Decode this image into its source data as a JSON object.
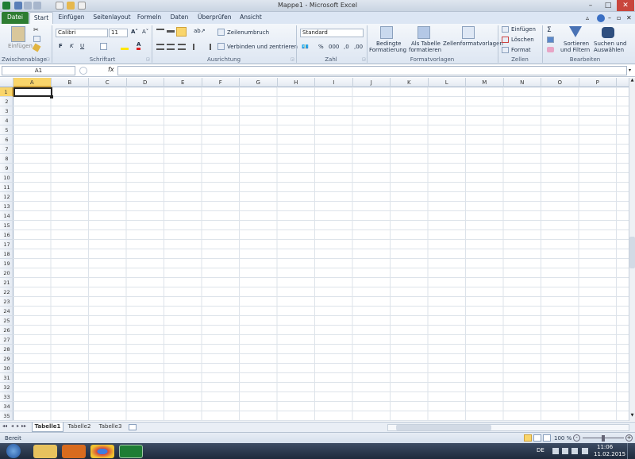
{
  "window": {
    "title": "Mappe1 - Microsoft Excel"
  },
  "tabs": [
    "Datei",
    "Start",
    "Einfügen",
    "Seitenlayout",
    "Formeln",
    "Daten",
    "Überprüfen",
    "Ansicht"
  ],
  "ribbon": {
    "paste_label": "Einfügen",
    "font_name": "Calibri",
    "font_size": "11",
    "bold": "F",
    "italic": "K",
    "underline": "U",
    "wrap_text": "Zeilenumbruch",
    "merge_center": "Verbinden und zentrieren",
    "number_format": "Standard",
    "cond_format": "Bedingte",
    "cond_format2": "Formatierung",
    "as_table": "Als Tabelle",
    "as_table2": "formatieren",
    "cell_styles": "Zellenformatvorlagen",
    "insert": "Einfügen",
    "delete": "Löschen",
    "format": "Format",
    "sort_filter": "Sortieren",
    "sort_filter2": "und Filtern",
    "find_select": "Suchen und",
    "find_select2": "Auswählen",
    "groups": {
      "clipboard": "Zwischenablage",
      "font": "Schriftart",
      "alignment": "Ausrichtung",
      "number": "Zahl",
      "styles": "Formatvorlagen",
      "cells": "Zellen",
      "editing": "Bearbeiten"
    }
  },
  "formula_bar": {
    "name_box": "A1",
    "fx": "fx",
    "value": ""
  },
  "columns": [
    "A",
    "B",
    "C",
    "D",
    "E",
    "F",
    "G",
    "H",
    "I",
    "J",
    "K",
    "L",
    "M",
    "N",
    "O",
    "P"
  ],
  "rows": [
    "1",
    "2",
    "3",
    "4",
    "5",
    "6",
    "7",
    "8",
    "9",
    "10",
    "11",
    "12",
    "13",
    "14",
    "15",
    "16",
    "17",
    "18",
    "19",
    "20",
    "21",
    "22",
    "23",
    "24",
    "25",
    "26",
    "27",
    "28",
    "29",
    "30",
    "31",
    "32",
    "33",
    "34",
    "35"
  ],
  "sheets": [
    "Tabelle1",
    "Tabelle2",
    "Tabelle3"
  ],
  "status": {
    "ready": "Bereit",
    "zoom": "100 %"
  },
  "taskbar": {
    "lang": "DE",
    "time": "11:06",
    "date": "11.02.2015"
  },
  "colors": {
    "accent": "#2e7d32",
    "selection": "#f9d56b"
  }
}
